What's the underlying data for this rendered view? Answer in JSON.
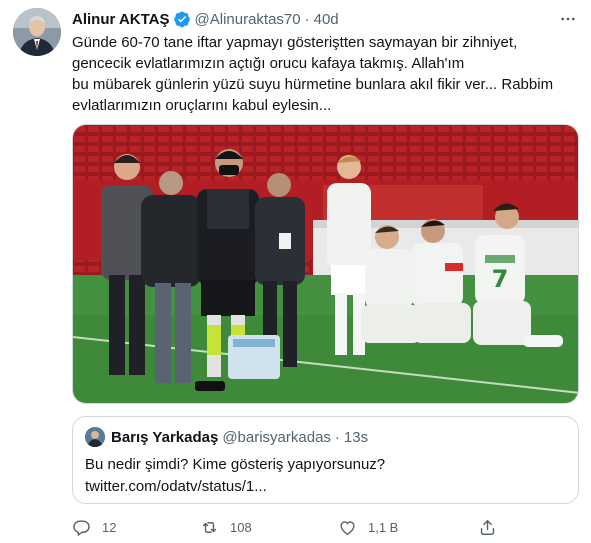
{
  "tweet": {
    "author_name": "Alinur AKTAŞ",
    "handle": "@Alinuraktas70",
    "separator": "·",
    "time": "40d",
    "lines": [
      "Günde 60-70 tane iftar yapmayı gösteriştten saymayan bir zihniyet,",
      "gencecik evlatlarımızın açtığı orucu kafaya takmış. Allah'ım",
      "bu mübarek günlerin yüzü suyu hürmetine bunlara akıl fikir ver... Rabbim",
      "evlatlarımızın oruçlarını kabul eylesin..."
    ]
  },
  "media": {
    "jersey_number": "7"
  },
  "quote": {
    "author_name": "Barış Yarkadaş",
    "handle": "@barisyarkadas",
    "separator": "·",
    "time": "13s",
    "lines": [
      "Bu nedir şimdi? Kime gösteriş yapıyorsunuz?",
      "twitter.com/odatv/status/1..."
    ]
  },
  "actions": {
    "replies": "12",
    "retweets": "108",
    "likes": "1,1 B"
  },
  "icons": {
    "verified": "verified-badge-icon",
    "more": "more-icon",
    "reply": "reply-icon",
    "retweet": "retweet-icon",
    "like": "like-icon",
    "share": "share-icon"
  },
  "colors": {
    "text": "#0f1419",
    "secondary": "#536471",
    "verified": "#1d9bf0",
    "border": "#cfd9de"
  }
}
